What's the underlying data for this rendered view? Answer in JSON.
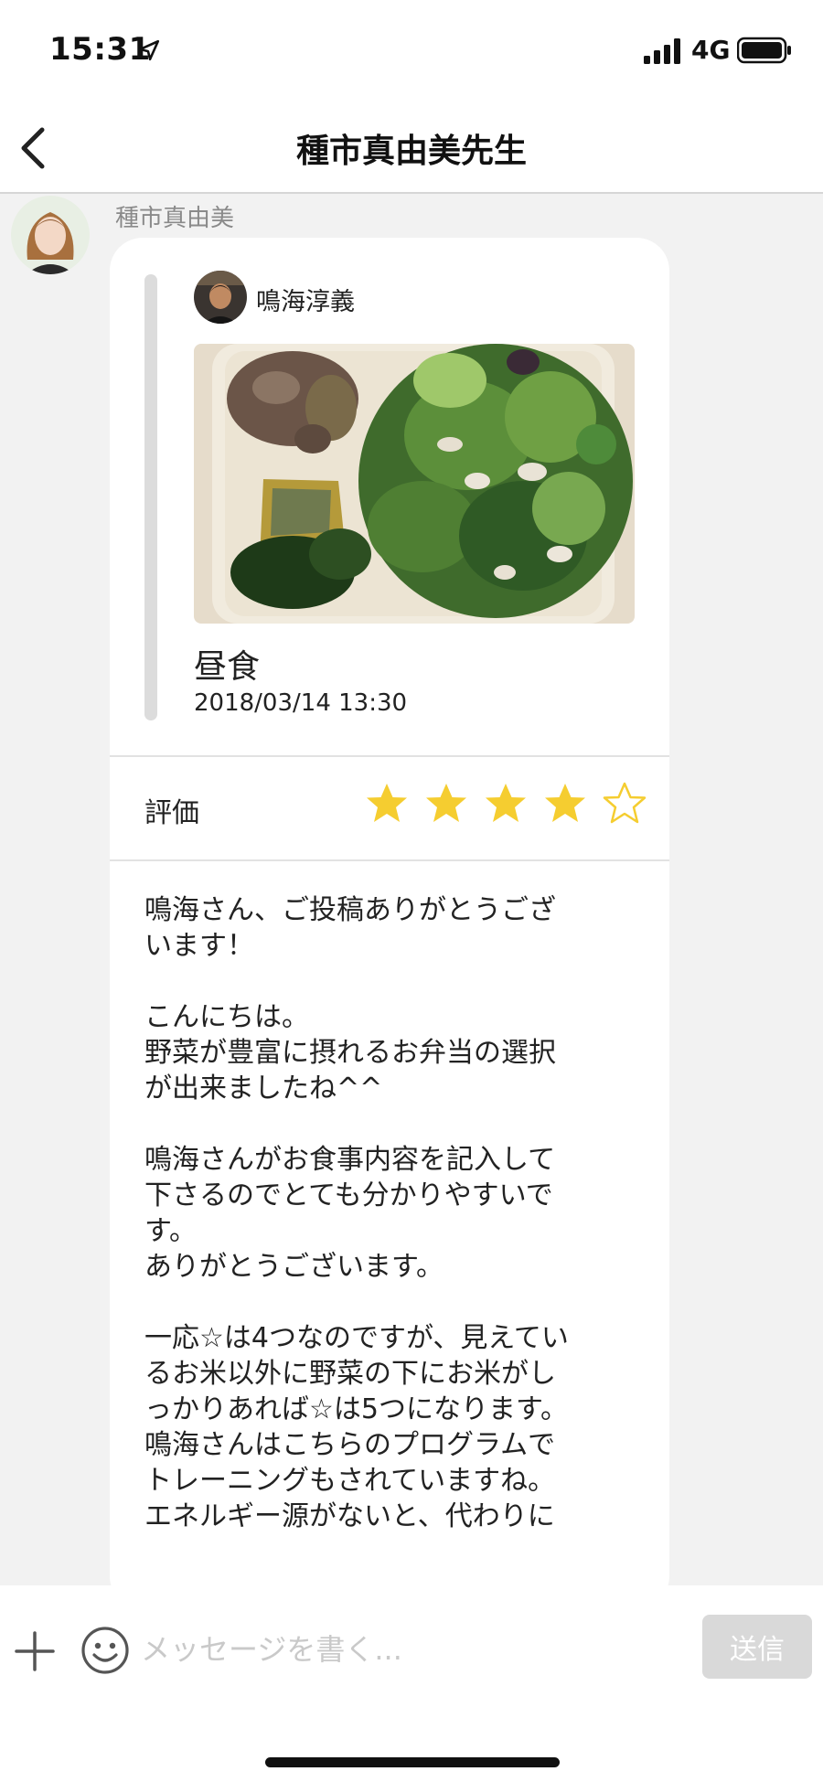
{
  "status_bar": {
    "time": "15:31",
    "network": "4G",
    "icons": [
      "location-arrow-icon",
      "signal-bars-icon",
      "battery-icon"
    ]
  },
  "nav": {
    "back_icon": "chevron-left-icon",
    "title": "種市真由美先生"
  },
  "message": {
    "sender": "種市真由美",
    "quoted_post": {
      "poster_name": "鳴海淳義",
      "photo": "meal-photo",
      "title": "昼食",
      "datetime": "2018/03/14 13:30"
    },
    "rating": {
      "label": "評価",
      "stars_filled": 4,
      "stars_total": 5,
      "star_color": "#f5cd30"
    },
    "comment": "鳴海さん、ご投稿ありがとうござ\nいます！\n\nこんにちは。\n野菜が豊富に摂れるお弁当の選択\nが出来ましたね^^\n\n鳴海さんがお食事内容を記入して\n下さるのでとても分かりやすいで\nす。\nありがとうございます。\n\n一応☆は4つなのですが、見えてい\nるお米以外に野菜の下にお米がし\nっかりあれば☆は5つになります。\n鳴海さんはこちらのプログラムで\nトレーニングもされていますね。\nエネルギー源がないと、代わりに"
  },
  "input_bar": {
    "placeholder": "メッセージを書く...",
    "send_label": "送信",
    "icons": [
      "plus-icon",
      "emoji-icon"
    ]
  }
}
